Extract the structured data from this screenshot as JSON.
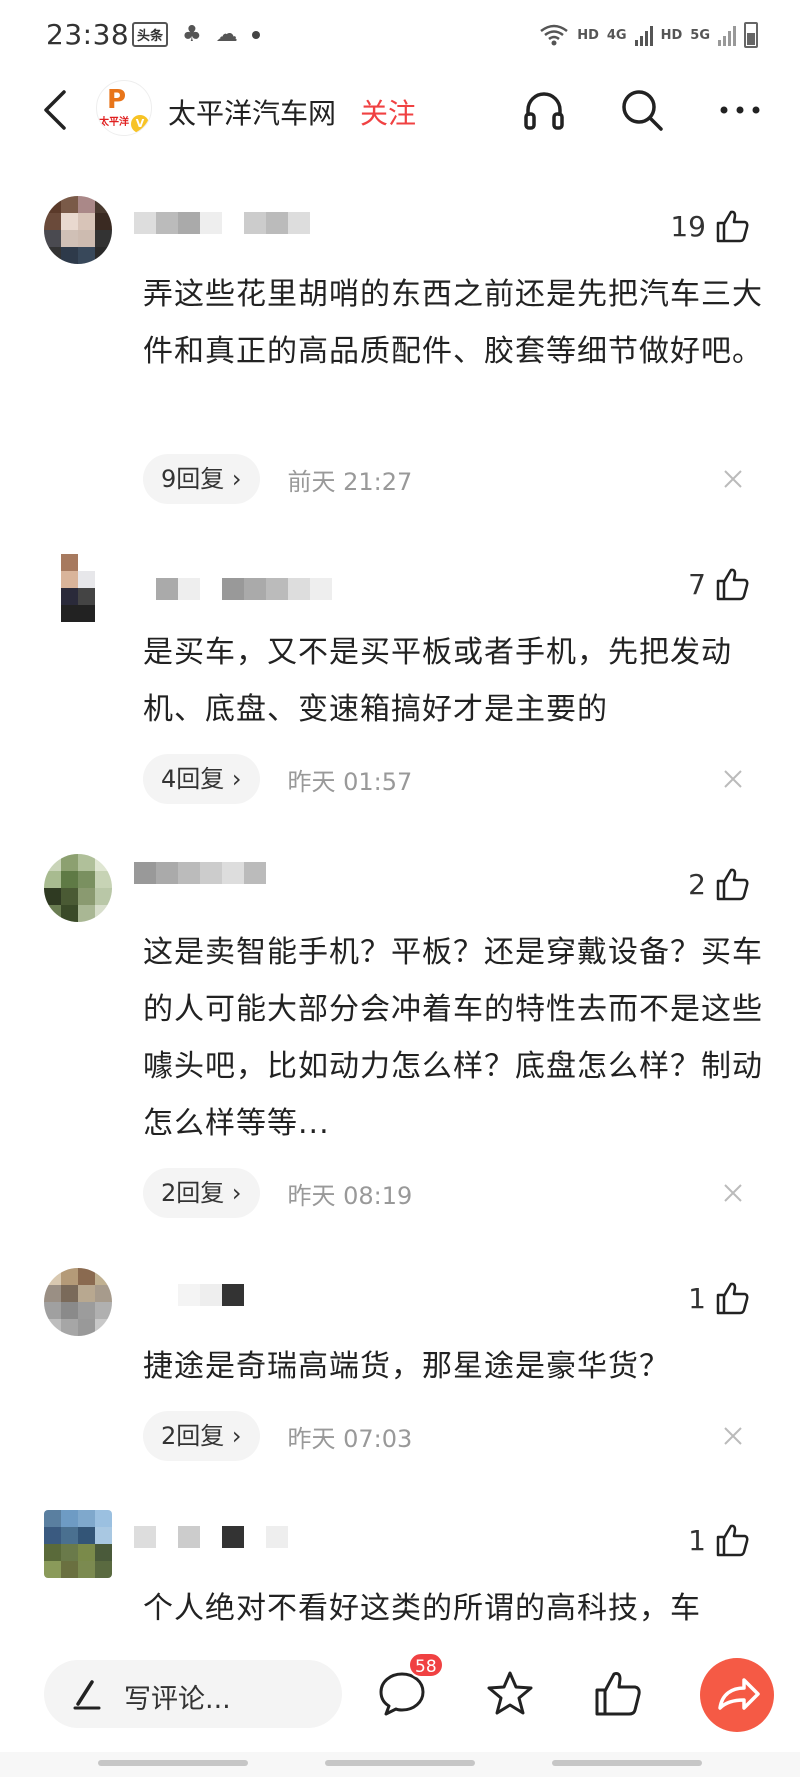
{
  "status_bar": {
    "time": "23:38",
    "news_icon_text": "头条",
    "network_hd_1": "HD",
    "network_4g": "4G",
    "network_hd_2": "HD",
    "network_5g": "5G"
  },
  "header": {
    "channel_name": "太平洋汽车网",
    "follow_label": "关注",
    "logo_text": "太平洋",
    "logo_badge": "V"
  },
  "comments": [
    {
      "likes": "19",
      "text": "弄这些花里胡哨的东西之前还是先把汽车三大件和真正的高品质配件、胶套等细节做好吧。",
      "reply_label": "9回复 ›",
      "time": "前天  21:27"
    },
    {
      "likes": "7",
      "text": "是买车，又不是买平板或者手机，先把发动机、底盘、变速箱搞好才是主要的",
      "reply_label": "4回复 ›",
      "time": "昨天  01:57"
    },
    {
      "likes": "2",
      "text": "这是卖智能手机？平板？还是穿戴设备？买车的人可能大部分会冲着车的特性去而不是这些噱头吧，比如动力怎么样？底盘怎么样？制动怎么样等等...",
      "reply_label": "2回复 ›",
      "time": "昨天  08:19"
    },
    {
      "likes": "1",
      "text": "捷途是奇瑞高端货，那星途是豪华货？",
      "reply_label": "2回复 ›",
      "time": "昨天  07:03"
    },
    {
      "likes": "1",
      "text": "个人绝对不看好这类的所谓的高科技，车"
    }
  ],
  "bottom_bar": {
    "write_placeholder": "写评论...",
    "comment_count": "58"
  },
  "colors": {
    "accent_red": "#f04142",
    "share_orange": "#f55a45",
    "meta_gray": "#999999"
  }
}
